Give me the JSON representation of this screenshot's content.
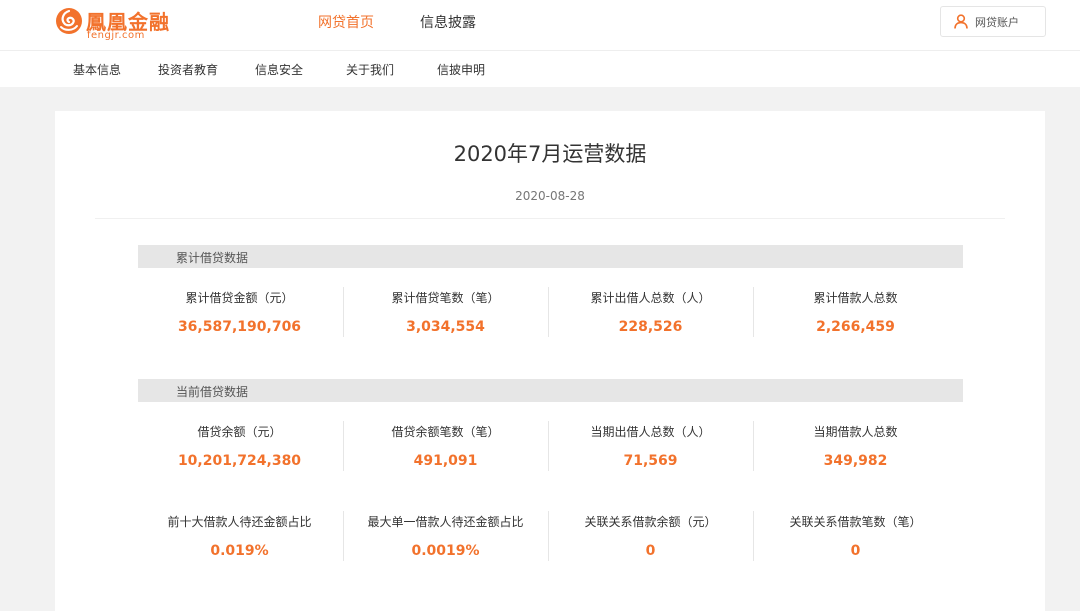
{
  "brand": {
    "name_cn": "鳳凰金融",
    "name_en": "fengjr.com",
    "color": "#f2722c"
  },
  "mainnav": [
    {
      "label": "网贷首页",
      "active": true
    },
    {
      "label": "信息披露",
      "active": false
    }
  ],
  "account": {
    "label": "网贷账户",
    "icon": "user-icon"
  },
  "subnav": [
    "基本信息",
    "投资者教育",
    "信息安全",
    "关于我们",
    "信披申明"
  ],
  "report": {
    "title": "2020年7月运营数据",
    "date": "2020-08-28"
  },
  "cumulative": {
    "heading": "累计借贷数据",
    "stats": [
      {
        "label": "累计借贷金额（元）",
        "value": "36,587,190,706"
      },
      {
        "label": "累计借贷笔数（笔）",
        "value": "3,034,554"
      },
      {
        "label": "累计出借人总数（人）",
        "value": "228,526"
      },
      {
        "label": "累计借款人总数",
        "value": "2,266,459"
      }
    ]
  },
  "current": {
    "heading": "当前借贷数据",
    "stats": [
      {
        "label": "借贷余额（元）",
        "value": "10,201,724,380"
      },
      {
        "label": "借贷余额笔数（笔）",
        "value": "491,091"
      },
      {
        "label": "当期出借人总数（人）",
        "value": "71,569"
      },
      {
        "label": "当期借款人总数",
        "value": "349,982"
      }
    ],
    "stats2": [
      {
        "label": "前十大借款人待还金额占比",
        "value": "0.019%"
      },
      {
        "label": "最大单一借款人待还金额占比",
        "value": "0.0019%"
      },
      {
        "label": "关联关系借款余额（元）",
        "value": "0"
      },
      {
        "label": "关联关系借款笔数（笔）",
        "value": "0"
      }
    ]
  }
}
